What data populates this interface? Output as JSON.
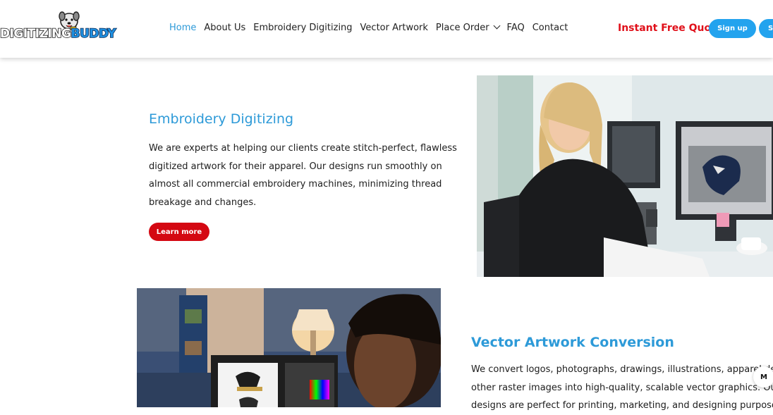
{
  "logo": {
    "word1": "DIGITIZING",
    "word2": "BUDDY"
  },
  "nav": {
    "items": [
      "Home",
      "About Us",
      "Embroidery Digitizing",
      "Vector Artwork",
      "Place Order",
      "FAQ",
      "Contact"
    ],
    "active": "Home"
  },
  "header": {
    "quote_label": "Instant Free Quote",
    "signup_label": "Sign up",
    "cut_button_label": "S"
  },
  "section1": {
    "title": "Embroidery Digitizing",
    "body": "We are experts at helping our clients create stitch-perfect, flawless digitized artwork for their apparel. Our designs run smoothly on almost all commercial embroidery machines, minimizing thread breakage and changes.",
    "button_label": "Learn more"
  },
  "section2": {
    "title": "Vector Artwork Conversion",
    "lines": [
      "We convert logos, photographs, drawings, illustrations, apparel desi",
      "other raster images into high-quality, scalable vector graphics. Our vecto",
      "designs are perfect for printing, marketing, and designing purposes."
    ]
  },
  "floating_badge": "M",
  "colors": {
    "accent": "#2d9ad8",
    "signup": "#23a3ee",
    "learn_more": "#d40812",
    "quote": "#e0101a"
  }
}
